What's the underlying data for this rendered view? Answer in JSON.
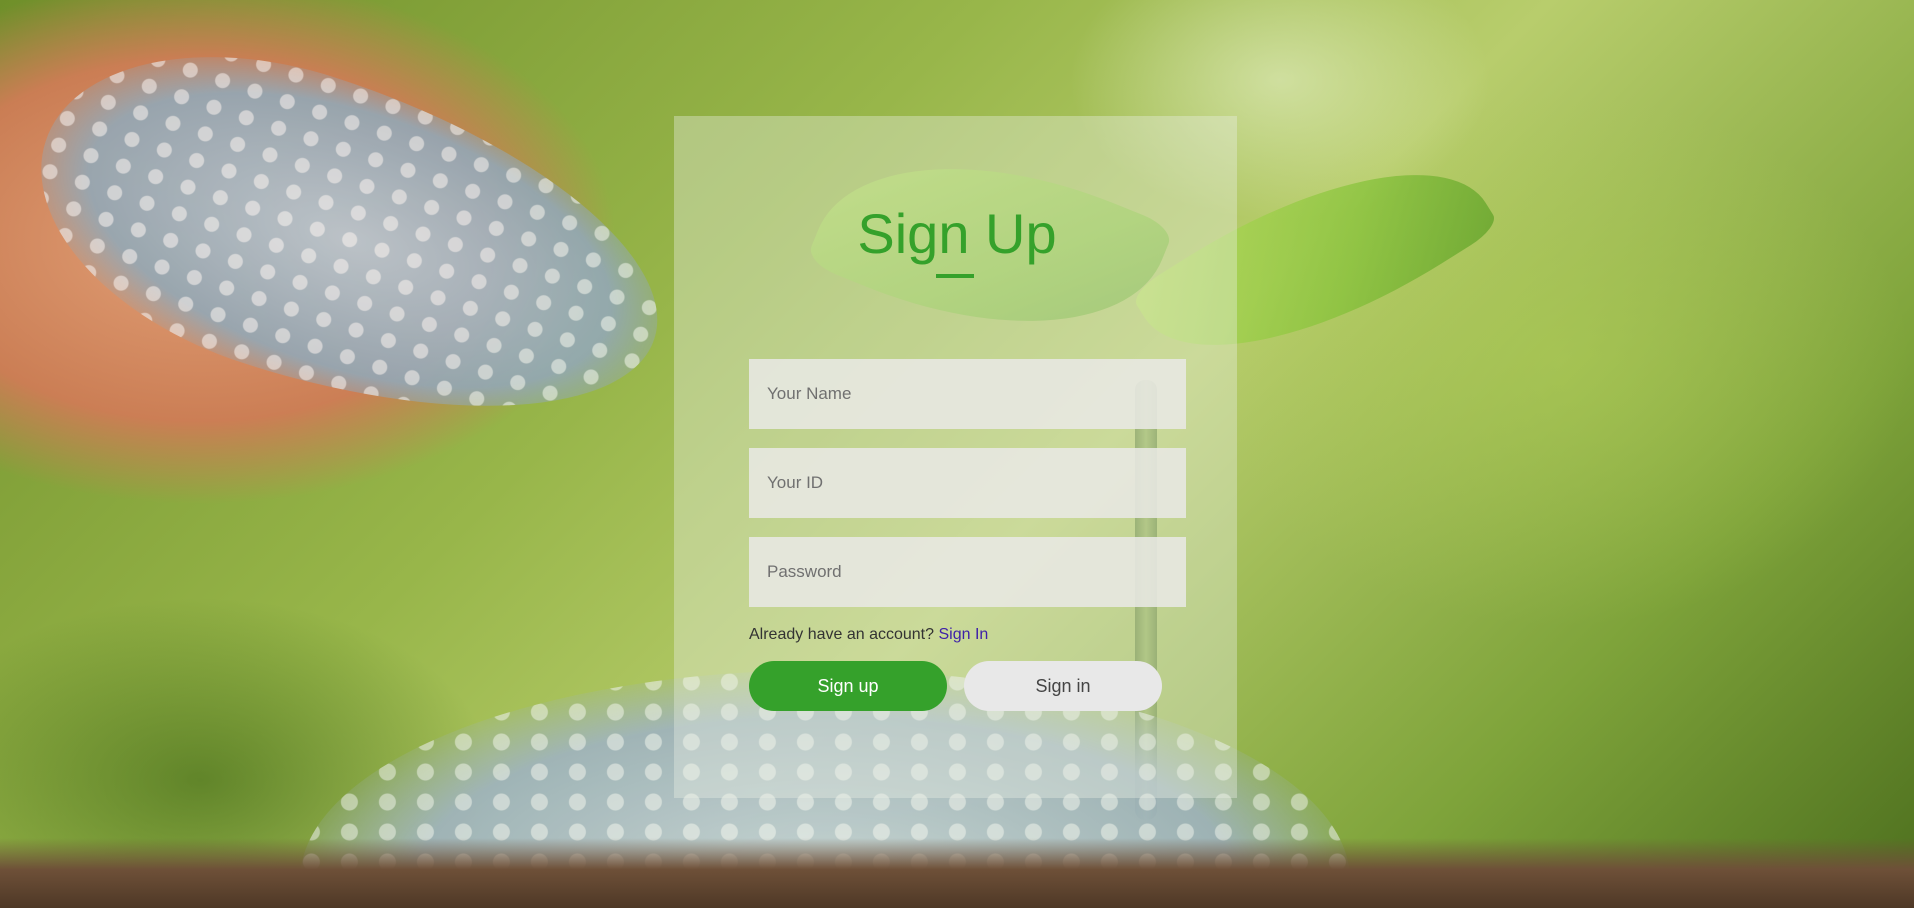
{
  "form": {
    "title": "Sign Up",
    "name_placeholder": "Your Name",
    "id_placeholder": "Your ID",
    "password_placeholder": "Password",
    "account_prompt": "Already have an account?",
    "account_link": "Sign In",
    "signup_button": "Sign up",
    "signin_button": "Sign in"
  },
  "colors": {
    "accent": "#35a12b",
    "link": "#3d1fa8",
    "secondary_button": "#e8e8e8"
  }
}
